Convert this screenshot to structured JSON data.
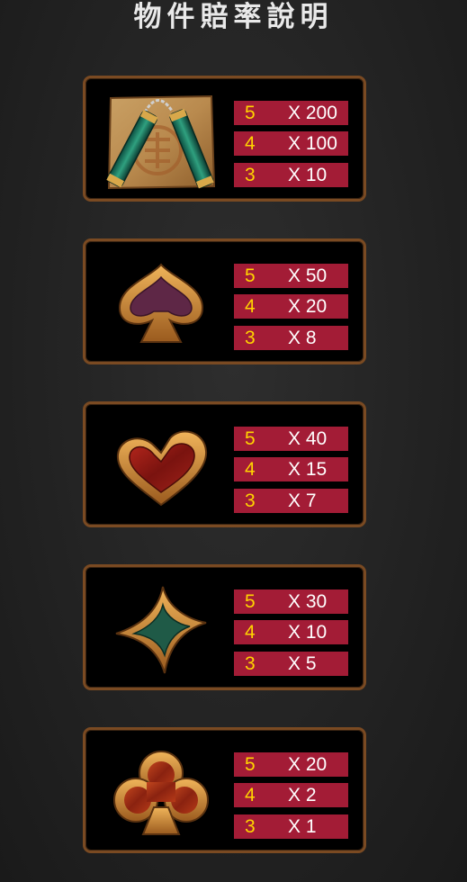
{
  "title": "物件賠率說明",
  "symbols": [
    {
      "icon": "nunchaku-icon",
      "payouts": [
        {
          "count": "5",
          "multiplier": "X 200"
        },
        {
          "count": "4",
          "multiplier": "X 100"
        },
        {
          "count": "3",
          "multiplier": "X 10"
        }
      ]
    },
    {
      "icon": "spade-icon",
      "payouts": [
        {
          "count": "5",
          "multiplier": "X 50"
        },
        {
          "count": "4",
          "multiplier": "X 20"
        },
        {
          "count": "3",
          "multiplier": "X 8"
        }
      ]
    },
    {
      "icon": "heart-icon",
      "payouts": [
        {
          "count": "5",
          "multiplier": "X 40"
        },
        {
          "count": "4",
          "multiplier": "X 15"
        },
        {
          "count": "3",
          "multiplier": "X 7"
        }
      ]
    },
    {
      "icon": "diamond-icon",
      "payouts": [
        {
          "count": "5",
          "multiplier": "X 30"
        },
        {
          "count": "4",
          "multiplier": "X 10"
        },
        {
          "count": "3",
          "multiplier": "X 5"
        }
      ]
    },
    {
      "icon": "club-icon",
      "payouts": [
        {
          "count": "5",
          "multiplier": "X 20"
        },
        {
          "count": "4",
          "multiplier": "X 2"
        },
        {
          "count": "3",
          "multiplier": "X 1"
        }
      ]
    }
  ],
  "colors": {
    "background": "#262626",
    "card_border": "#7a4a22",
    "pay_row": "#a31c36",
    "count_text": "#ffd400",
    "multiplier_text": "#ffffff"
  }
}
